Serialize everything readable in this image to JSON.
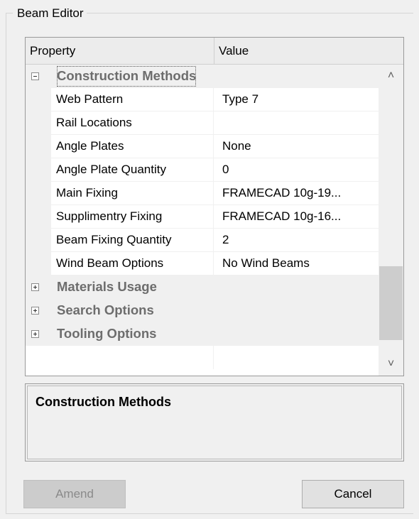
{
  "group": {
    "title": "Beam Editor"
  },
  "grid": {
    "headers": {
      "property": "Property",
      "value": "Value"
    },
    "categories": [
      {
        "label": "Construction Methods",
        "expanded": true,
        "properties": [
          {
            "name": "Web Pattern",
            "value": "Type 7"
          },
          {
            "name": "Rail Locations",
            "value": ""
          },
          {
            "name": "Angle Plates",
            "value": "None"
          },
          {
            "name": "Angle Plate Quantity",
            "value": "0"
          },
          {
            "name": "Main Fixing",
            "value": "FRAMECAD 10g-19..."
          },
          {
            "name": "Supplimentry Fixing",
            "value": "FRAMECAD 10g-16..."
          },
          {
            "name": "Beam Fixing Quantity",
            "value": "2"
          },
          {
            "name": "Wind Beam Options",
            "value": "No Wind Beams"
          }
        ]
      },
      {
        "label": "Materials Usage",
        "expanded": false
      },
      {
        "label": "Search Options",
        "expanded": false
      },
      {
        "label": "Tooling Options",
        "expanded": false
      }
    ]
  },
  "scrollbar": {
    "up_icon": "chevron-up-icon",
    "down_icon": "chevron-down-icon"
  },
  "description": {
    "title": "Construction Methods",
    "text": ""
  },
  "buttons": {
    "amend": "Amend",
    "cancel": "Cancel",
    "amend_enabled": false
  },
  "colors": {
    "category_text": "#6d6d6d",
    "grid_margin": "#f0f0f0",
    "button_disabled": "#cccccc"
  }
}
